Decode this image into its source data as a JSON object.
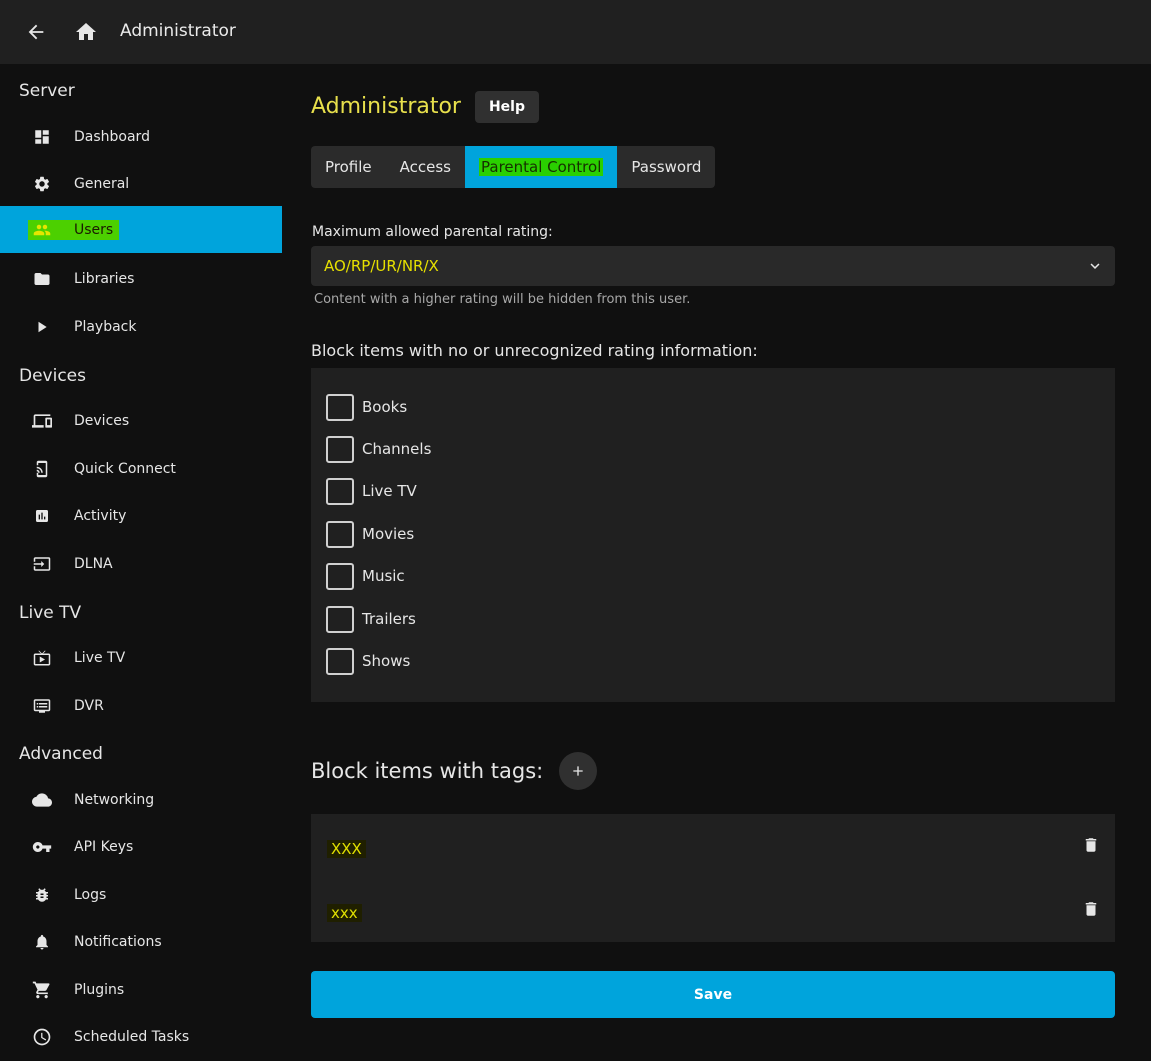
{
  "topbar": {
    "back_icon": "arrow-left-icon",
    "home_icon": "home-icon",
    "title": "Administrator"
  },
  "sidebar": {
    "sections": [
      {
        "title": "Server"
      },
      {
        "title": "Devices"
      },
      {
        "title": "Live TV"
      },
      {
        "title": "Advanced"
      }
    ],
    "items": [
      {
        "label": "Dashboard",
        "icon": "dashboard-icon"
      },
      {
        "label": "General",
        "icon": "gear-icon"
      },
      {
        "label": "Users",
        "icon": "users-icon",
        "active": true
      },
      {
        "label": "Libraries",
        "icon": "folder-icon"
      },
      {
        "label": "Playback",
        "icon": "play-icon"
      },
      {
        "label": "Devices",
        "icon": "devices-icon"
      },
      {
        "label": "Quick Connect",
        "icon": "phonelink-icon"
      },
      {
        "label": "Activity",
        "icon": "activity-icon"
      },
      {
        "label": "DLNA",
        "icon": "input-icon"
      },
      {
        "label": "Live TV",
        "icon": "live-tv-icon"
      },
      {
        "label": "DVR",
        "icon": "dvr-icon"
      },
      {
        "label": "Networking",
        "icon": "cloud-icon"
      },
      {
        "label": "API Keys",
        "icon": "key-icon"
      },
      {
        "label": "Logs",
        "icon": "bug-icon"
      },
      {
        "label": "Notifications",
        "icon": "bell-icon"
      },
      {
        "label": "Plugins",
        "icon": "cart-icon"
      },
      {
        "label": "Scheduled Tasks",
        "icon": "clock-icon"
      }
    ]
  },
  "main": {
    "title": "Administrator",
    "help_label": "Help",
    "tabs": [
      {
        "label": "Profile"
      },
      {
        "label": "Access"
      },
      {
        "label": "Parental Control",
        "active": true
      },
      {
        "label": "Password"
      }
    ],
    "rating_label": "Maximum allowed parental rating:",
    "rating_value": "AO/RP/UR/NR/X",
    "rating_hint": "Content with a higher rating will be hidden from this user.",
    "block_label": "Block items with no or unrecognized rating information:",
    "block_items": [
      {
        "label": "Books",
        "checked": false
      },
      {
        "label": "Channels",
        "checked": false
      },
      {
        "label": "Live TV",
        "checked": false
      },
      {
        "label": "Movies",
        "checked": false
      },
      {
        "label": "Music",
        "checked": false
      },
      {
        "label": "Trailers",
        "checked": false
      },
      {
        "label": "Shows",
        "checked": false
      }
    ],
    "tags_label": "Block items with tags:",
    "tags": [
      {
        "value": "XXX"
      },
      {
        "value": "xxx"
      }
    ],
    "save_label": "Save"
  },
  "colors": {
    "accent": "#00a4dc",
    "highlight_yellow": "#e6e000",
    "highlight_green": "#2ad000"
  }
}
